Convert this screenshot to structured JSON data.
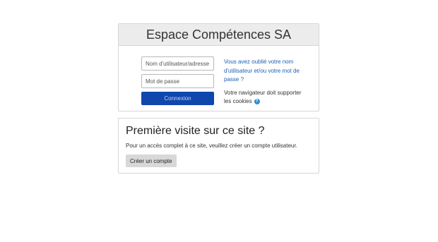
{
  "login": {
    "title": "Espace Compétences SA",
    "username_placeholder": "Nom d'utilisateur/adresse de",
    "password_placeholder": "Mot de passe",
    "login_button": "Connexion",
    "forgot_link": "Vous avez oublié votre nom d'utilisateur et/ou votre mot de passe ?",
    "cookies_note": "Votre navigateur doit supporter les cookies",
    "help_icon": "question-circle-icon"
  },
  "signup": {
    "title": "Première visite sur ce site ?",
    "description": "Pour un accès complet à ce site, veuillez créer un compte utilisateur.",
    "create_button": "Créer un compte"
  },
  "colors": {
    "accent": "#0f47ad",
    "link": "#1b5fb5",
    "header_bg": "#ececec",
    "help_icon": "#2a8fd4"
  }
}
